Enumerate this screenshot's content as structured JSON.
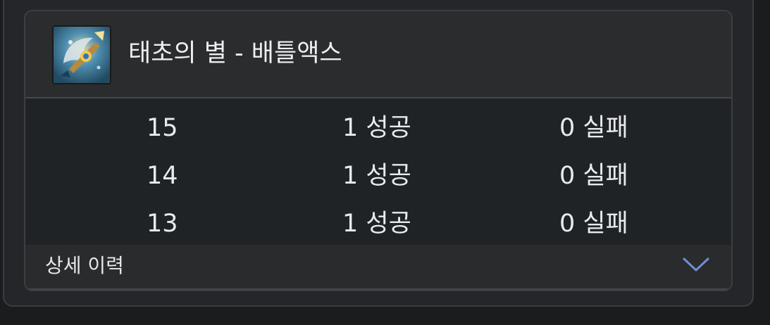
{
  "item": {
    "title": "태초의 별 - 배틀액스",
    "icon": "battle-axe-item-icon"
  },
  "history": [
    {
      "level": "15",
      "success": "1 성공",
      "fail": "0 실패"
    },
    {
      "level": "14",
      "success": "1 성공",
      "fail": "0 실패"
    },
    {
      "level": "13",
      "success": "1 성공",
      "fail": "0 실패"
    }
  ],
  "footer": {
    "label": "상세 이력",
    "toggle_icon": "chevron-down-icon"
  },
  "colors": {
    "accent": "#6f8fd6",
    "background": "#1b1c1e",
    "card": "#202326",
    "header": "#2b2c2e"
  }
}
